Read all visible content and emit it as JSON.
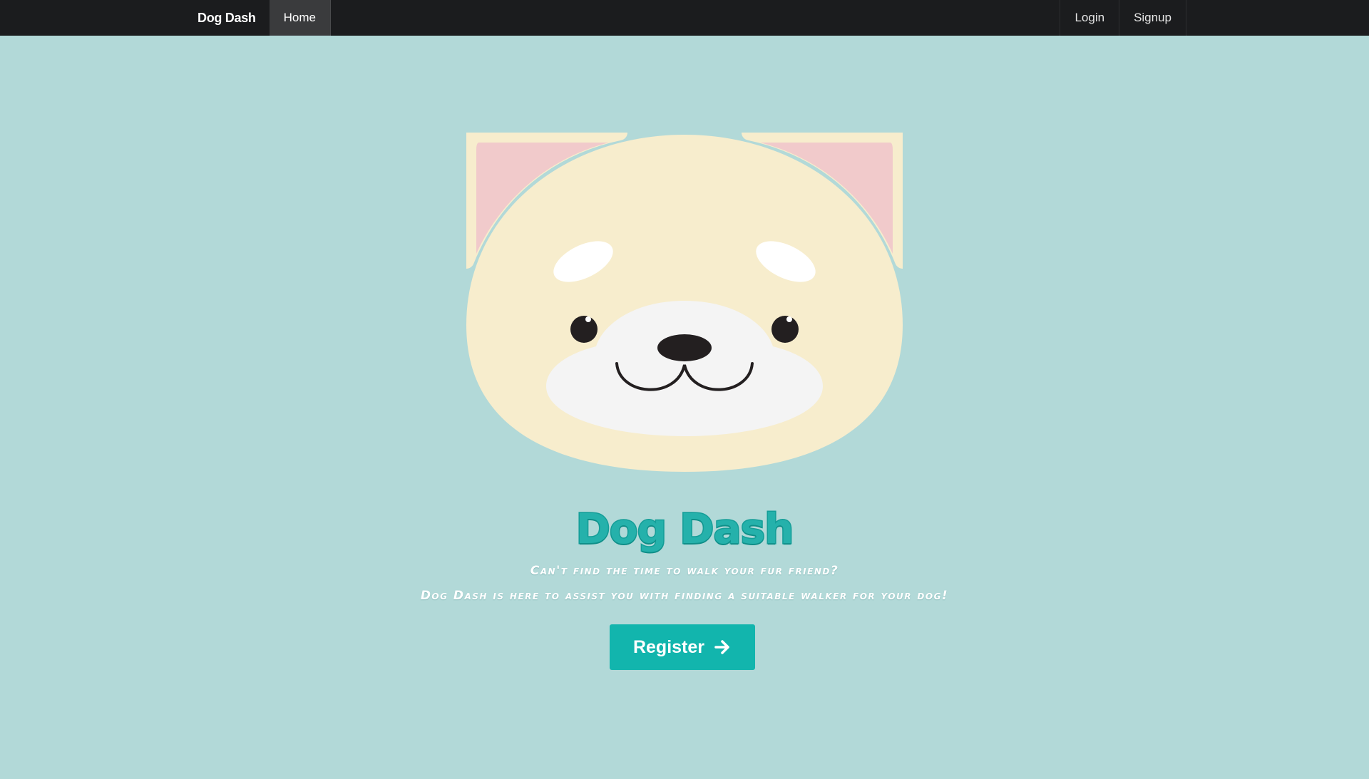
{
  "nav": {
    "brand": "Dog Dash",
    "home": "Home",
    "login": "Login",
    "signup": "Signup"
  },
  "hero": {
    "title": "Dog Dash",
    "tagline_line1": "Can't find the time to walk your fur friend?",
    "tagline_line2": "Dog Dash is here to assist you with finding a suitable walker for your dog!",
    "register_label": "Register",
    "register_icon": "arrow-right-icon",
    "illustration": "dog-face-icon"
  },
  "colors": {
    "navbar": "#1b1c1e",
    "background": "#b2d9d8",
    "accent": "#12b5ad",
    "title": "#25b1ab",
    "dog_fur": "#f7edcd",
    "dog_ear_inner": "#f1cacb",
    "dog_muzzle": "#f4f4f4"
  }
}
